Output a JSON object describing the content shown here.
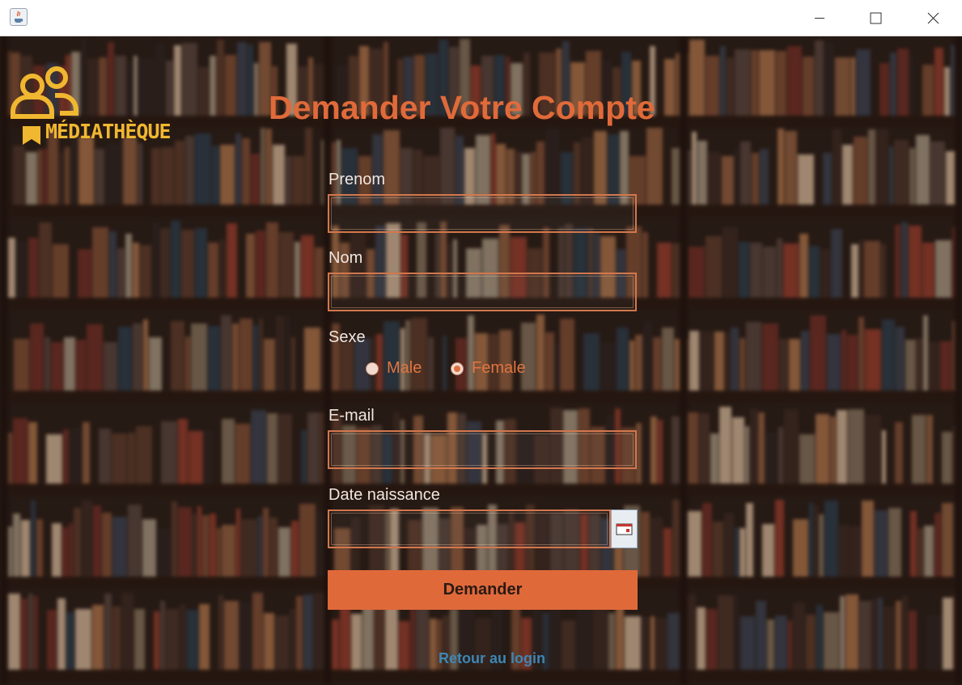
{
  "window": {
    "app_icon": "java-cup-icon",
    "controls": [
      "minimize-icon",
      "maximize-icon",
      "close-icon"
    ]
  },
  "brand": {
    "logo_text": "MÉDIATHÈQUE",
    "logo_icon": "users-icon",
    "bookmark_icon": "bookmark-icon",
    "color": "#f0b730"
  },
  "form": {
    "title": "Demander Votre Compte",
    "prenom_label": "Prenom",
    "prenom_value": "",
    "nom_label": "Nom",
    "nom_value": "",
    "sexe_label": "Sexe",
    "sexe_options": [
      "Male",
      "Female"
    ],
    "sexe_selected": "Female",
    "email_label": "E-mail",
    "email_value": "",
    "date_label": "Date naissance",
    "date_value": "",
    "calendar_icon": "calendar-icon",
    "submit_label": "Demander",
    "back_link": "Retour au login"
  },
  "colors": {
    "accent": "#e0693a",
    "field_border": "#d2774d",
    "link": "#3d87b5",
    "label": "#f1e6de"
  }
}
